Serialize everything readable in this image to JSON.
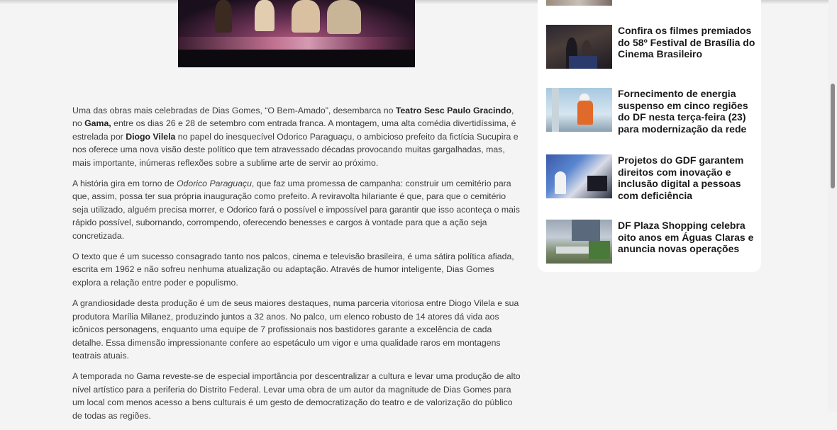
{
  "article": {
    "p1": {
      "a": "Uma das obras mais celebradas de Dias Gomes, “O Bem-Amado”, desembarca no ",
      "b1": "Teatro Sesc Paulo Gracindo",
      "c": ", no ",
      "b2": "Gama,",
      "d": " entre os dias 26 e 28 de setembro com entrada franca. A montagem, uma alta comédia divertidíssima, é estrelada por ",
      "b3": "Diogo Vilela",
      "e": " no papel do inesquecível Odorico Paraguaçu, o ambicioso prefeito da fictícia Sucupira e nos oferece uma nova visão deste político que tem atravessado décadas provocando muitas gargalhadas, mas, mais importante, inúmeras reflexões sobre a sublime arte de servir ao próximo."
    },
    "p2": {
      "a": "A história gira em torno de ",
      "i": "Odorico Paraguaçu",
      "b": ", que faz uma promessa de campanha: construir um cemitério para que, assim, possa ter sua própria inauguração como prefeito. A reviravolta hilariante é que, para que o cemitério seja utilizado, alguém precisa morrer, e Odorico fará o possível e impossível para garantir que isso aconteça o mais rápido possível, subornando, corrompendo, oferecendo benesses e cargos à vontade para que a ação seja concretizada."
    },
    "p3": "O texto que é um sucesso consagrado tanto nos palcos, cinema e televisão brasileira, é uma sátira política afiada, escrita em 1962 e não sofreu nenhuma atualização ou adaptação. Através de humor inteligente, Dias Gomes explora a relação entre poder e populismo.",
    "p4": "A grandiosidade desta produção é um de seus maiores destaques, numa parceria vitoriosa entre Diogo Vilela e sua produtora Marília Milanez, produzindo juntos a 32 anos. No palco, um elenco robusto de 14 atores dá vida aos icônicos personagens, enquanto uma equipe de 7 profissionais nos bastidores garante a excelência de cada detalhe. Essa dimensão impressionante confere ao espetáculo um vigor e uma qualidade raros em montagens teatrais atuais.",
    "p5": "A temporada no Gama reveste-se de especial importância por descentralizar a cultura e levar uma produção de alto nível artístico para a periferia do Distrito Federal. Levar uma obra de um autor da magnitude de Dias Gomes para um local com menos acesso a bens culturais é um gesto de democratização do teatro e de valorização do público de todas as regiões."
  },
  "sidebar": {
    "items": [
      {
        "headline": "Confira os filmes premiados do 58º Festival de Brasília do Cinema Brasileiro"
      },
      {
        "headline": "Fornecimento de energia suspenso em cinco regiões do DF nesta terça-feira (23) para modernização da rede"
      },
      {
        "headline": "Projetos do GDF garantem direitos com inovação e inclusão digital a pessoas com deficiência"
      },
      {
        "headline": "DF Plaza Shopping celebra oito anos em Águas Claras e anuncia novas operações"
      }
    ]
  }
}
